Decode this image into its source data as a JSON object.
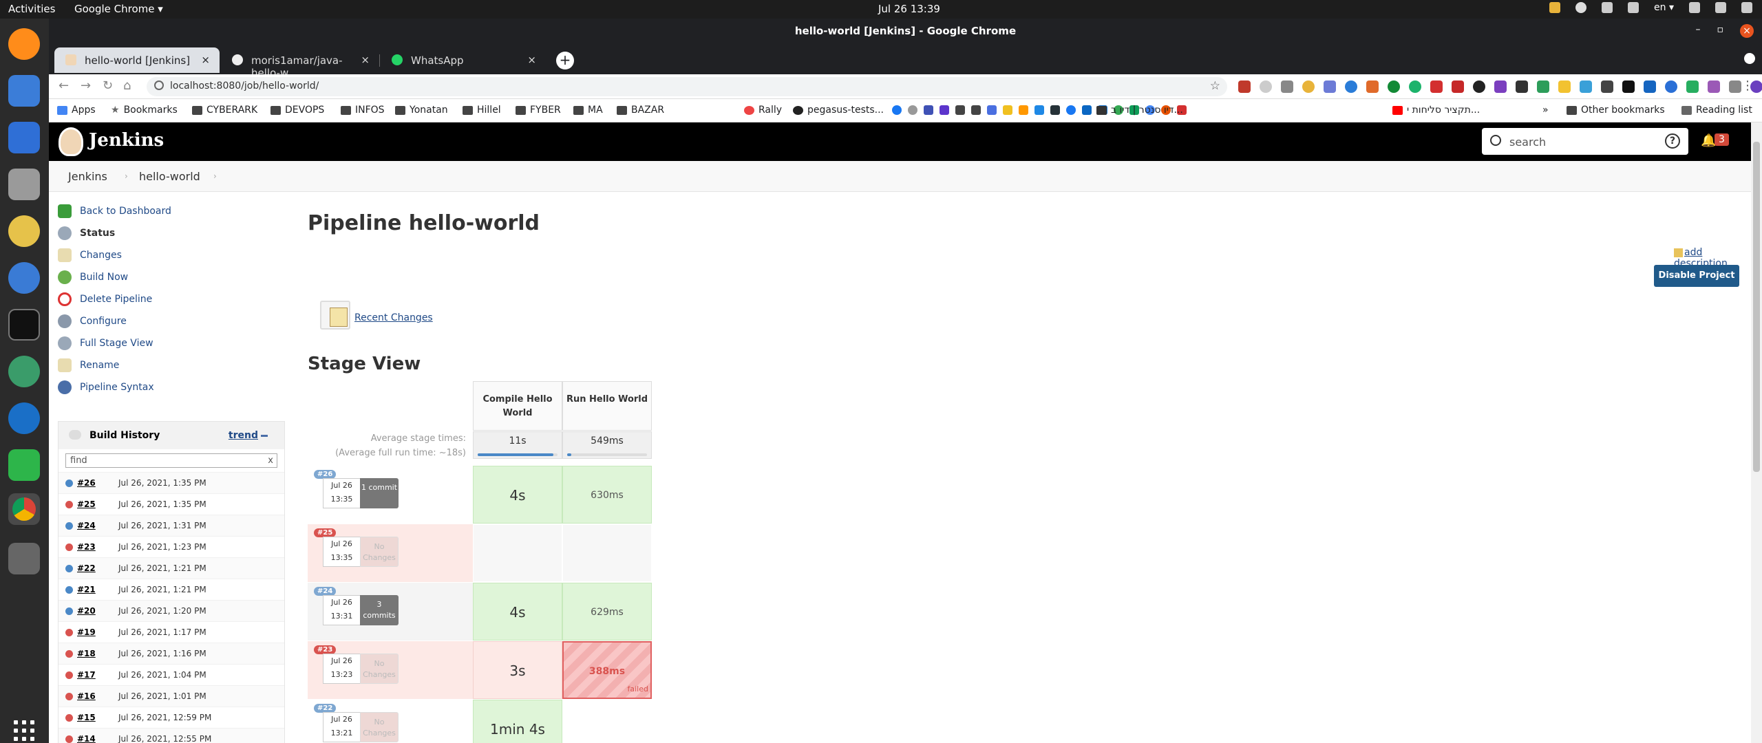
{
  "os": {
    "activities": "Activities",
    "app": "Google Chrome ▾",
    "clock": "Jul 26  13:39",
    "lang": "en ▾"
  },
  "window": {
    "title": "hello-world [Jenkins] - Google Chrome"
  },
  "tabs": [
    {
      "label": "hello-world [Jenkins]"
    },
    {
      "label": "moris1amar/java-hello-w"
    },
    {
      "label": "WhatsApp"
    }
  ],
  "toolbar": {
    "url": "localhost:8080/job/hello-world/"
  },
  "bookmarks": {
    "apps": "Apps",
    "items": [
      "Bookmarks",
      "CYBERARK",
      "DEVOPS",
      "INFOS",
      "Yonatan",
      "Hillel",
      "FYBER",
      "MA",
      "BAZAR",
      "Rally",
      "pegasus-tests...",
      "דיו סנטר | דיו ב...",
      "תקציר סליחות י...",
      "Other bookmarks",
      "Reading list"
    ]
  },
  "jenkins": {
    "name": "Jenkins",
    "search_placeholder": "search",
    "help": "?",
    "notif_count": "3"
  },
  "breadcrumb": {
    "root": "Jenkins",
    "job": "hello-world"
  },
  "tasks": [
    "Back to Dashboard",
    "Status",
    "Changes",
    "Build Now",
    "Delete Pipeline",
    "Configure",
    "Full Stage View",
    "Rename",
    "Pipeline Syntax"
  ],
  "history": {
    "title": "Build History",
    "trend": "trend",
    "find": "find",
    "clear": "x",
    "builds": [
      {
        "num": "#26",
        "date": "Jul 26, 2021, 1:35 PM",
        "status": "blue"
      },
      {
        "num": "#25",
        "date": "Jul 26, 2021, 1:35 PM",
        "status": "red"
      },
      {
        "num": "#24",
        "date": "Jul 26, 2021, 1:31 PM",
        "status": "blue"
      },
      {
        "num": "#23",
        "date": "Jul 26, 2021, 1:23 PM",
        "status": "red"
      },
      {
        "num": "#22",
        "date": "Jul 26, 2021, 1:21 PM",
        "status": "blue"
      },
      {
        "num": "#21",
        "date": "Jul 26, 2021, 1:21 PM",
        "status": "blue"
      },
      {
        "num": "#20",
        "date": "Jul 26, 2021, 1:20 PM",
        "status": "blue"
      },
      {
        "num": "#19",
        "date": "Jul 26, 2021, 1:17 PM",
        "status": "red"
      },
      {
        "num": "#18",
        "date": "Jul 26, 2021, 1:16 PM",
        "status": "red"
      },
      {
        "num": "#17",
        "date": "Jul 26, 2021, 1:04 PM",
        "status": "red"
      },
      {
        "num": "#16",
        "date": "Jul 26, 2021, 1:01 PM",
        "status": "red"
      },
      {
        "num": "#15",
        "date": "Jul 26, 2021, 12:59 PM",
        "status": "red"
      },
      {
        "num": "#14",
        "date": "Jul 26, 2021, 12:55 PM",
        "status": "red"
      }
    ]
  },
  "main": {
    "title": "Pipeline hello-world",
    "add_description": "add description",
    "disable": "Disable Project",
    "recent_changes": "Recent Changes",
    "stage_view": "Stage View"
  },
  "stage_view": {
    "stages": [
      "Compile Hello World",
      "Run Hello World"
    ],
    "avg_label_1": "Average stage times:",
    "avg_label_2": "(Average full run time: ~18s)",
    "avg_times": [
      "11s",
      "549ms"
    ],
    "avg_fill": [
      0.95,
      0.05
    ],
    "runs": [
      {
        "num": "#26",
        "date": "Jul 26",
        "time": "13:35",
        "changes": "1 commit",
        "status": "ok",
        "cells": [
          "4s",
          "630ms"
        ]
      },
      {
        "num": "#25",
        "date": "Jul 26",
        "time": "13:35",
        "changes": "No Changes",
        "status": "failed",
        "cells": [
          "",
          ""
        ]
      },
      {
        "num": "#24",
        "date": "Jul 26",
        "time": "13:31",
        "changes": "3 commits",
        "status": "ok",
        "cells": [
          "4s",
          "629ms"
        ]
      },
      {
        "num": "#23",
        "date": "Jul 26",
        "time": "13:23",
        "changes": "No Changes",
        "status": "failed",
        "cells": [
          "3s",
          "388ms"
        ],
        "failed_label": "failed"
      },
      {
        "num": "#22",
        "date": "Jul 26",
        "time": "13:21",
        "changes": "No Changes",
        "status": "ok",
        "cells": [
          "1min 4s",
          ""
        ]
      }
    ]
  },
  "colors": {
    "blue": "#4a88c7",
    "red": "#d9534f",
    "green_cell": "#dff5d8",
    "fail_row": "#fde9e6"
  }
}
